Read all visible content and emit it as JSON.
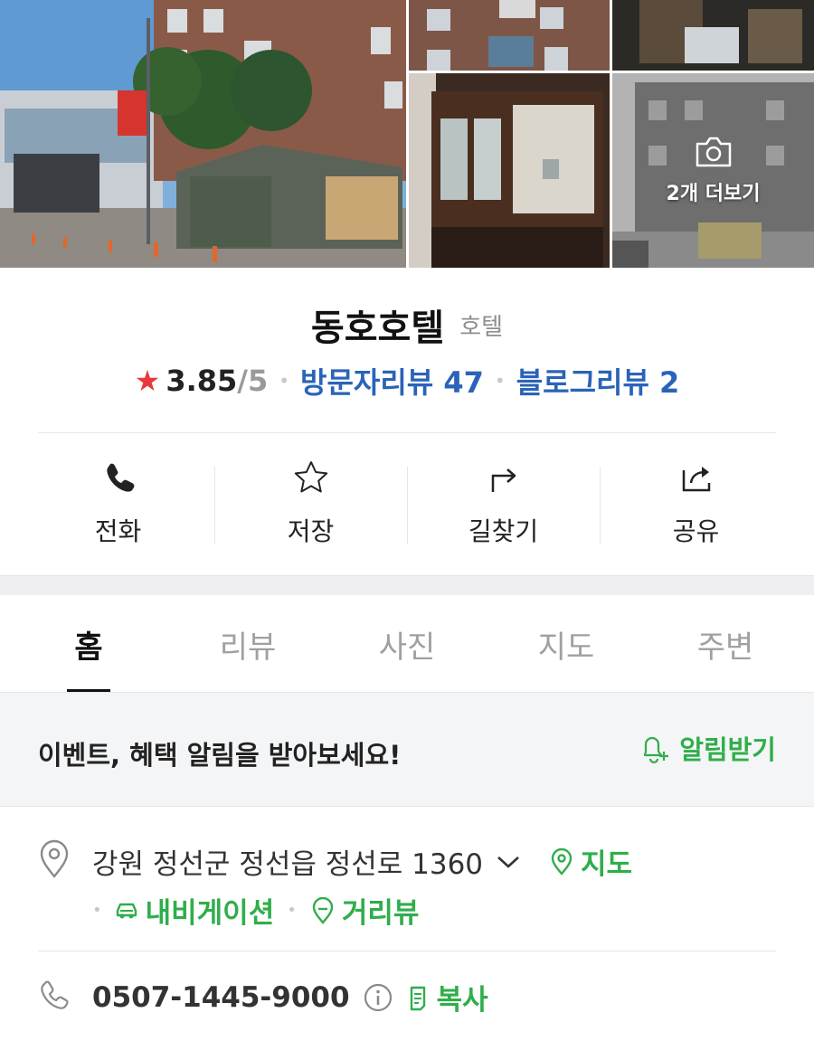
{
  "photos": {
    "more_label": "2개 더보기"
  },
  "place": {
    "name": "동호호텔",
    "category": "호텔"
  },
  "rating": {
    "score": "3.85",
    "max": "/5",
    "visitor_reviews": "방문자리뷰 47",
    "blog_reviews": "블로그리뷰 2"
  },
  "actions": [
    {
      "label": "전화",
      "icon": "phone-icon"
    },
    {
      "label": "저장",
      "icon": "star-outline-icon"
    },
    {
      "label": "길찾기",
      "icon": "directions-icon"
    },
    {
      "label": "공유",
      "icon": "share-icon"
    }
  ],
  "tabs": [
    {
      "label": "홈",
      "active": true
    },
    {
      "label": "리뷰",
      "active": false
    },
    {
      "label": "사진",
      "active": false
    },
    {
      "label": "지도",
      "active": false
    },
    {
      "label": "주변",
      "active": false
    }
  ],
  "banner": {
    "text": "이벤트, 혜택 알림을 받아보세요!",
    "button": "알림받기"
  },
  "address": {
    "text": "강원 정선군 정선읍 정선로 1360",
    "map_link": "지도",
    "navigation_link": "내비게이션",
    "streetview_link": "거리뷰"
  },
  "phone": {
    "number": "0507-1445-9000",
    "copy_label": "복사"
  },
  "colors": {
    "accent_green": "#2fae4a",
    "link_blue": "#2a63b8",
    "star_red": "#e8383d"
  }
}
